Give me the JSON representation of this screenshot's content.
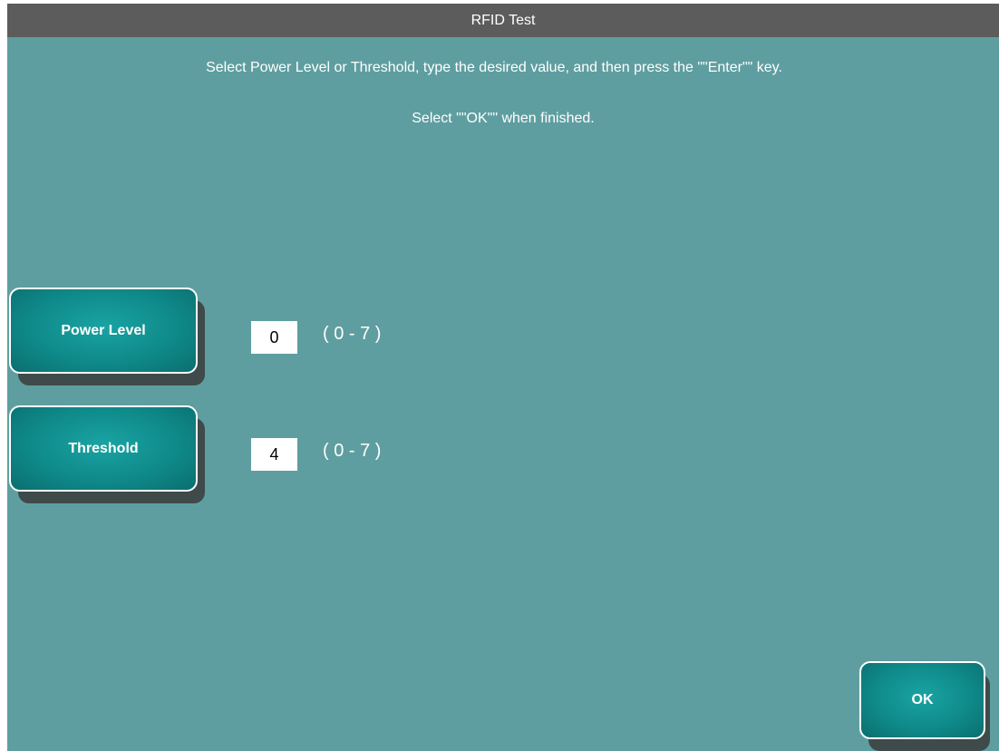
{
  "window": {
    "title": "RFID Test"
  },
  "instructions": {
    "line1": "Select Power Level or Threshold, type the desired value, and then press the \"\"Enter\"\" key.",
    "line2": "Select \"\"OK\"\" when finished."
  },
  "settings": [
    {
      "button_label": "Power Level",
      "value": "0",
      "range": "( 0 - 7 )"
    },
    {
      "button_label": "Threshold",
      "value": "4",
      "range": "( 0 - 7 )"
    }
  ],
  "footer": {
    "ok_label": "OK"
  },
  "colors": {
    "background": "#5f9ea0",
    "titlebar": "#5c5c5c",
    "button": "#0f8a8a"
  }
}
